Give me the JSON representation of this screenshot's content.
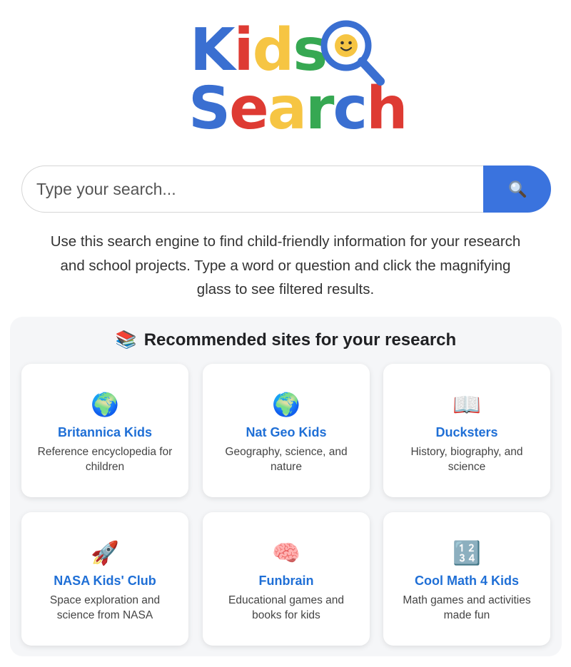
{
  "logo": {
    "word1_letters": [
      "K",
      "i",
      "d",
      "s"
    ],
    "word2_letters": [
      "S",
      "e",
      "a",
      "r",
      "c",
      "h"
    ],
    "colors": {
      "blue": "#3a6fd1",
      "red": "#de3b33",
      "yellow": "#f6c543",
      "green": "#36a852"
    },
    "icon": "magnifying-glass-smiley-icon"
  },
  "search": {
    "placeholder": "Type your search...",
    "button_icon": "magnifying-glass-icon",
    "button_color": "#3a73de"
  },
  "description": "Use this search engine to find child-friendly information for your research and school projects. Type a word or question and click the magnifying glass to see filtered results.",
  "recommended": {
    "title_icon": "📚",
    "title": "Recommended sites for your research",
    "sites": [
      {
        "icon": "🌍",
        "title": "Britannica Kids",
        "description": "Reference encyclopedia for children"
      },
      {
        "icon": "🌍",
        "title": "Nat Geo Kids",
        "description": "Geography, science, and nature"
      },
      {
        "icon": "📖",
        "title": "Ducksters",
        "description": "History, biography, and science"
      },
      {
        "icon": "🚀",
        "title": "NASA Kids' Club",
        "description": "Space exploration and science from NASA"
      },
      {
        "icon": "🧠",
        "title": "Funbrain",
        "description": "Educational games and books for kids"
      },
      {
        "icon": "🔢",
        "title": "Cool Math 4 Kids",
        "description": "Math games and activities made fun"
      }
    ]
  }
}
